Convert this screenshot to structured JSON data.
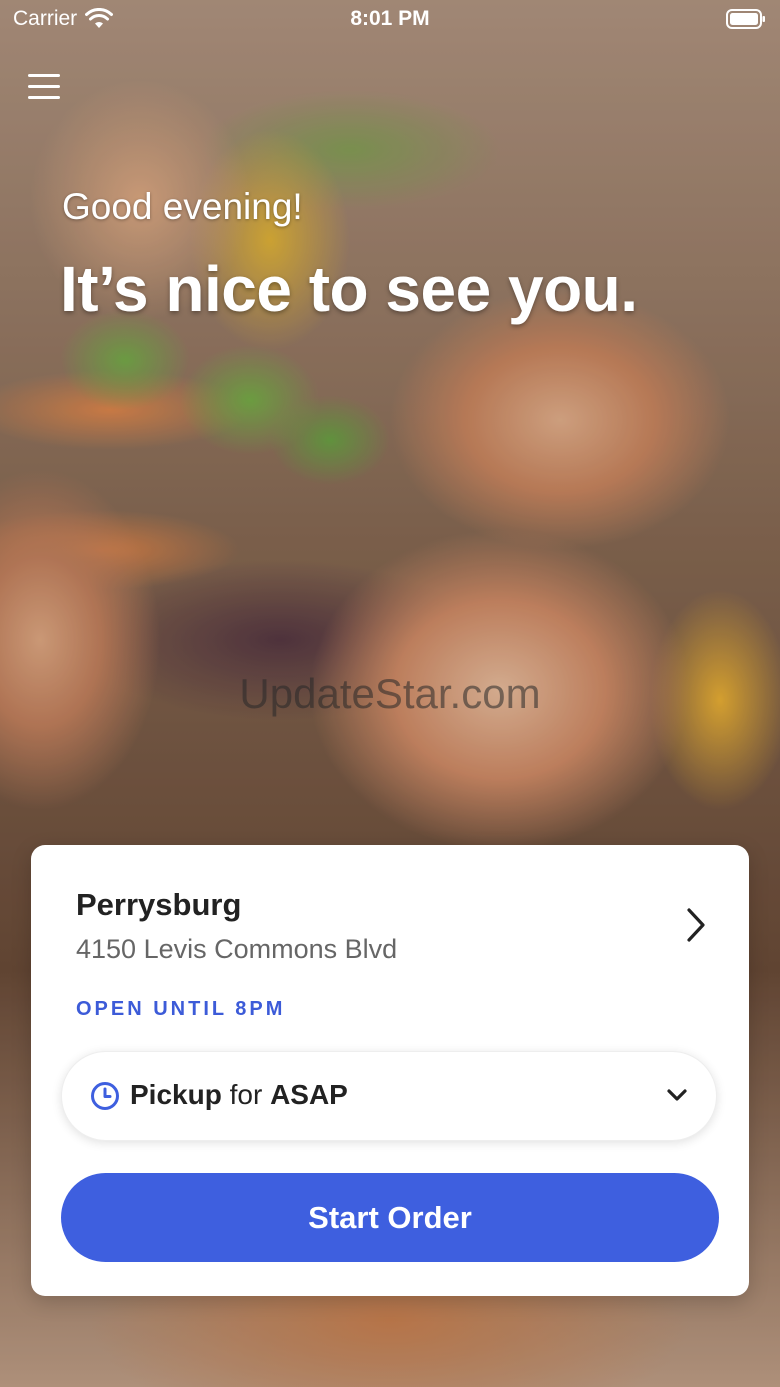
{
  "status_bar": {
    "carrier": "Carrier",
    "time": "8:01 PM"
  },
  "greeting": {
    "line1": "Good evening!",
    "line2": "It’s nice to see you."
  },
  "watermark": "UpdateStar.com",
  "location": {
    "name": "Perrysburg",
    "address": "4150 Levis Commons Blvd",
    "hours": "OPEN UNTIL 8PM"
  },
  "order_mode": {
    "mode": "Pickup",
    "connector": "for",
    "time": "ASAP"
  },
  "start_order_label": "Start Order",
  "colors": {
    "accent": "#3e5fdf",
    "hours_text": "#3c5bd8",
    "card_bg": "#ffffff"
  },
  "icons": [
    "wifi-icon",
    "battery-icon",
    "menu-icon",
    "chevron-right-icon",
    "clock-icon",
    "chevron-down-icon"
  ]
}
